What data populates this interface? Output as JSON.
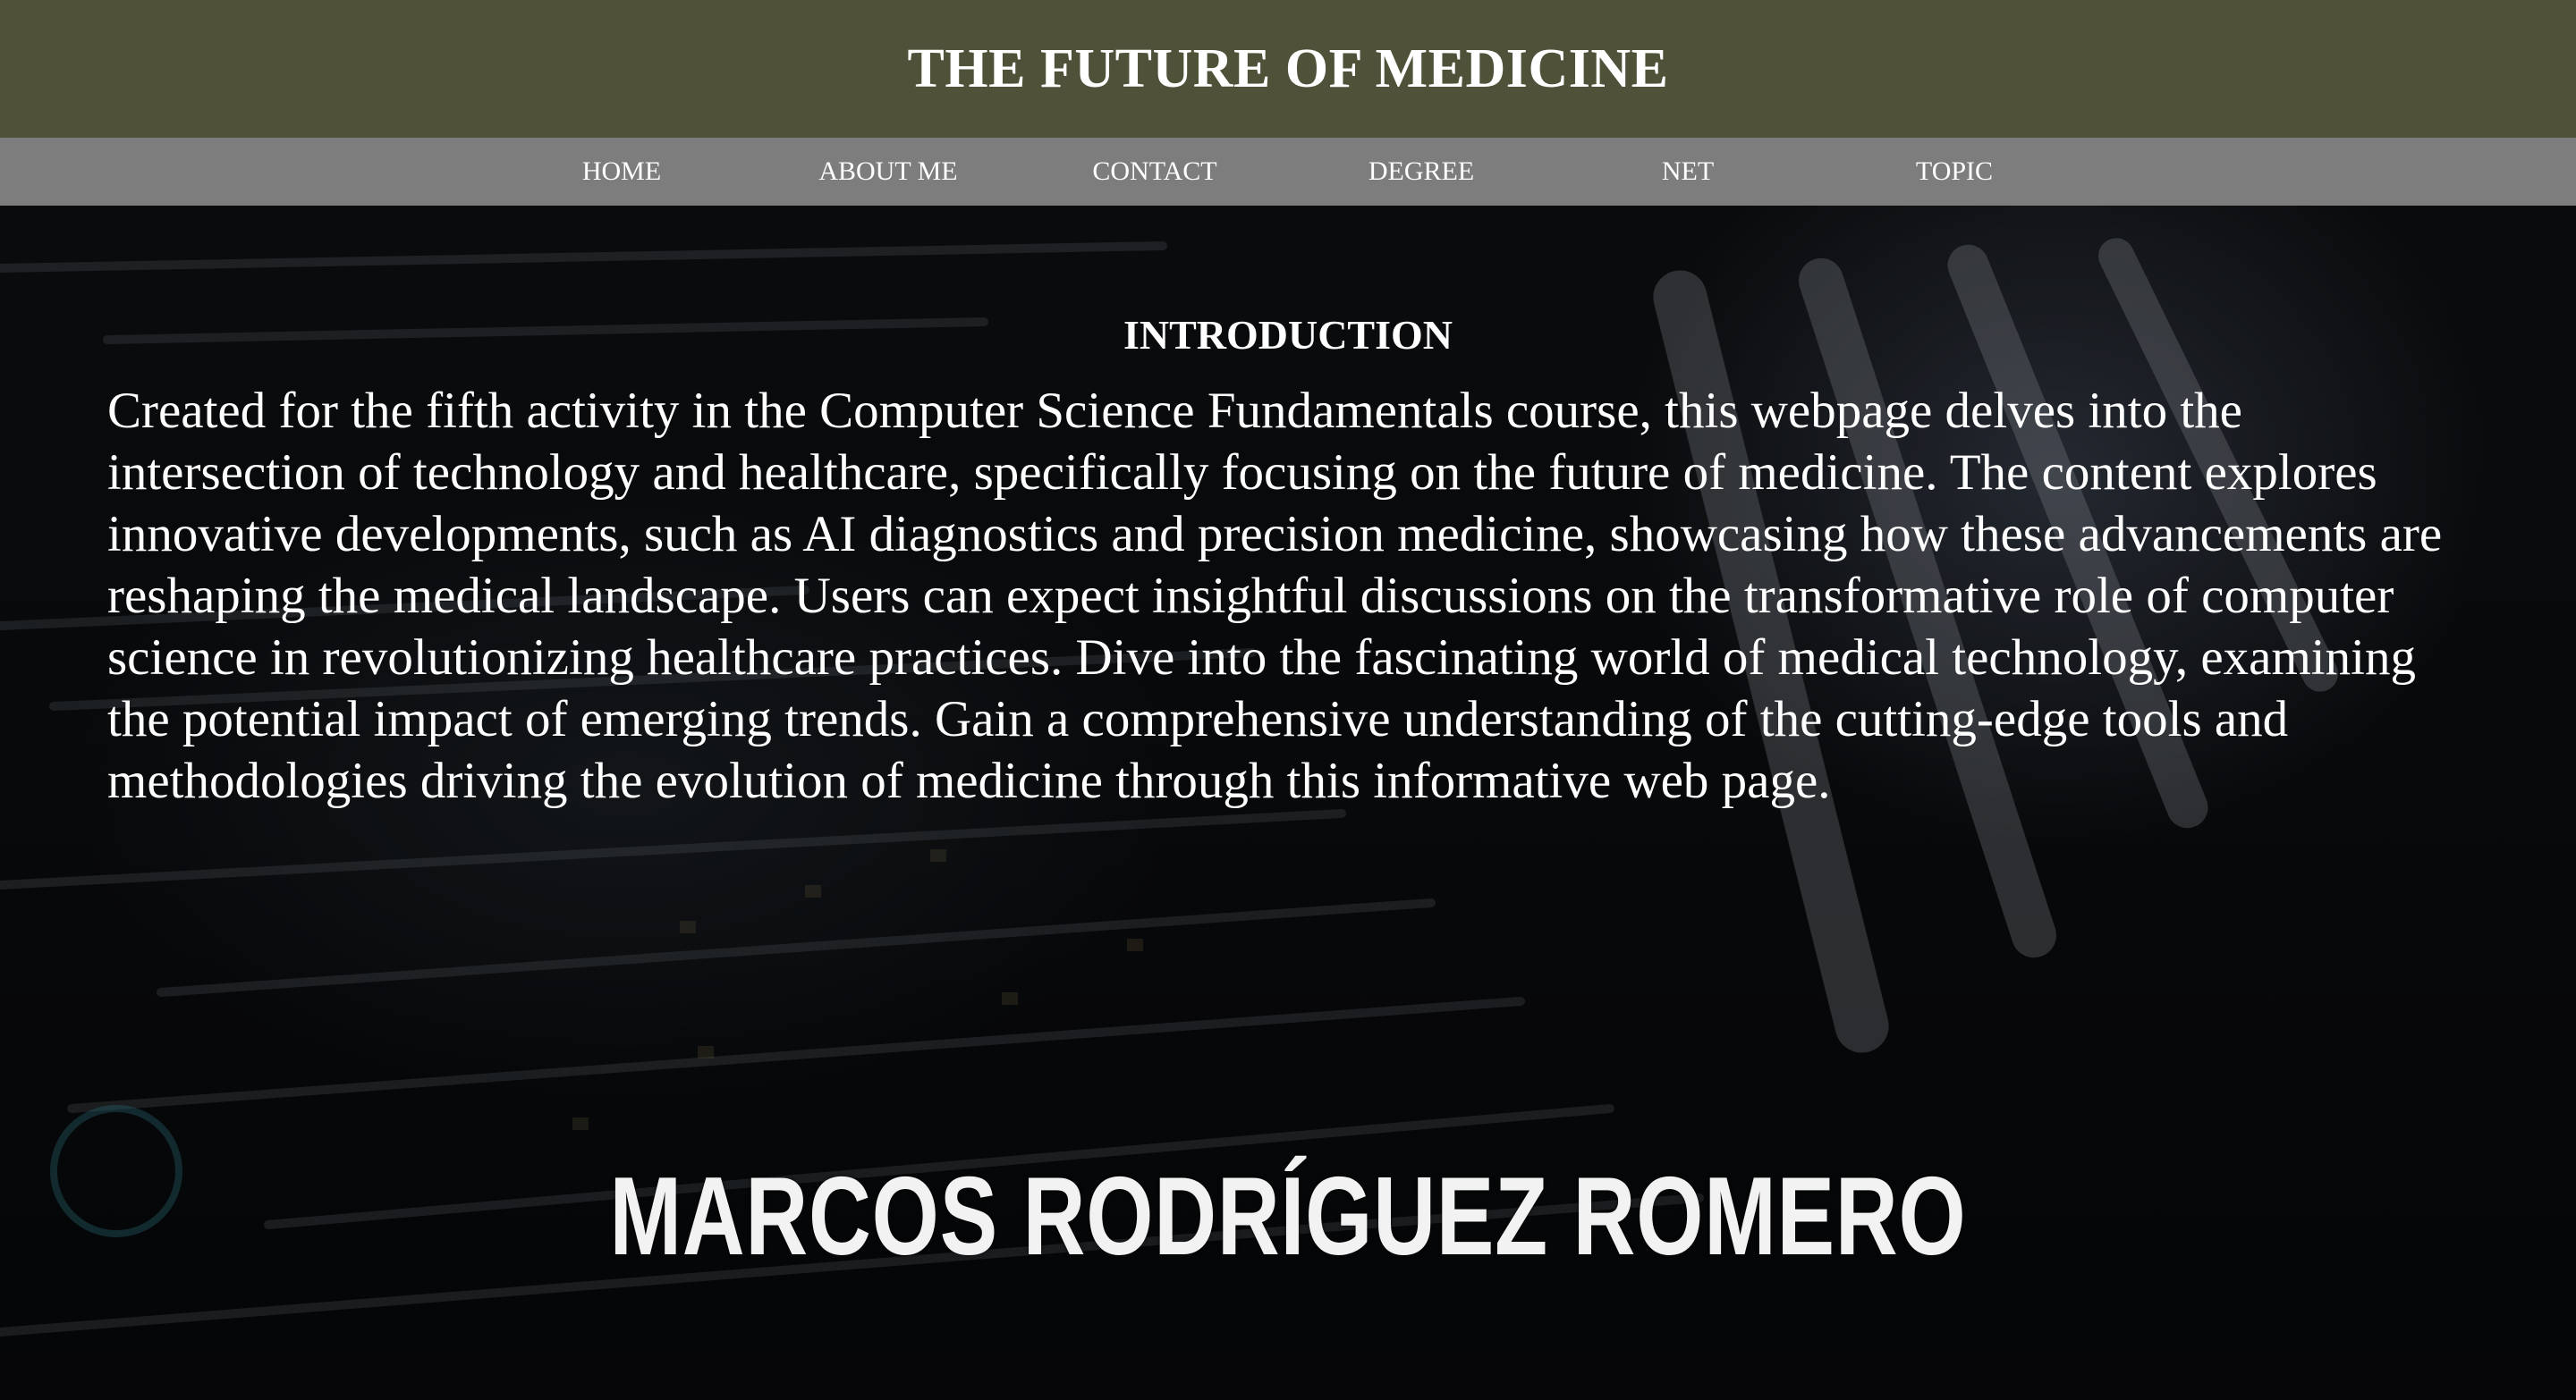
{
  "header": {
    "title": "THE FUTURE OF MEDICINE"
  },
  "nav": {
    "items": [
      {
        "label": "HOME"
      },
      {
        "label": "ABOUT ME"
      },
      {
        "label": "CONTACT"
      },
      {
        "label": "DEGREE"
      },
      {
        "label": "NET"
      },
      {
        "label": "TOPIC"
      }
    ]
  },
  "main": {
    "heading": "INTRODUCTION",
    "paragraph": "Created for the fifth activity in the Computer Science Fundamentals course, this webpage delves into the intersection of technology and healthcare, specifically focusing on the future of medicine. The content explores innovative developments, such as AI diagnostics and precision medicine, showcasing how these advancements are reshaping the medical landscape. Users can expect insightful discussions on the transformative role of computer science in revolutionizing healthcare practices. Dive into the fascinating world of medical technology, examining the potential impact of emerging trends. Gain a comprehensive understanding of the cutting-edge tools and methodologies driving the evolution of medicine through this informative web page."
  },
  "footer": {
    "author_name": "MARCOS RODRÍGUEZ ROMERO"
  },
  "colors": {
    "header_bg": "#4f5139",
    "nav_bg": "#7d7d7d",
    "text": "#ffffff"
  }
}
